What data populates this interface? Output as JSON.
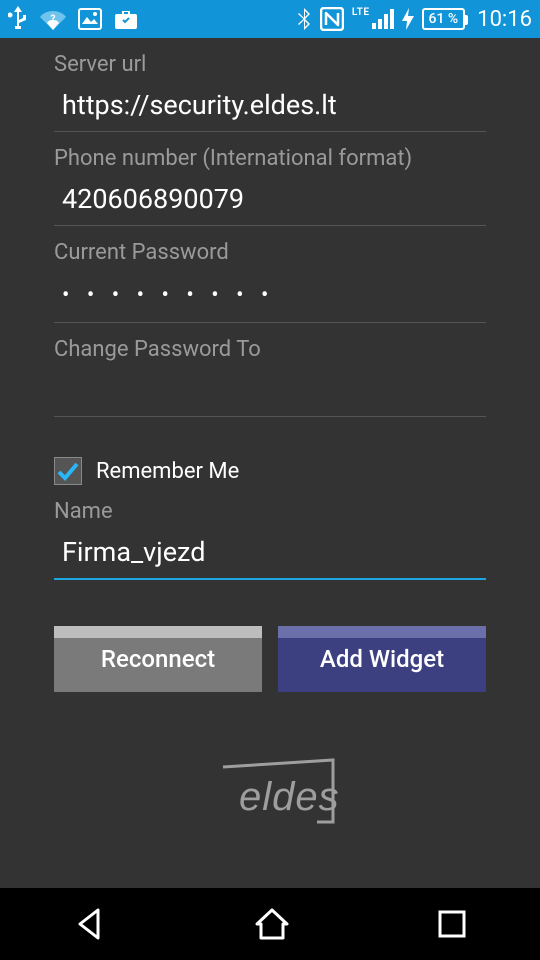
{
  "status": {
    "network_label": "LTE",
    "battery_text": "61 %",
    "time": "10:16"
  },
  "fields": {
    "server_url": {
      "label": "Server url",
      "value": "https://security.eldes.lt"
    },
    "phone": {
      "label": "Phone number (International format)",
      "value": "420606890079"
    },
    "current_pw": {
      "label": "Current Password",
      "masked": "• • • • • • • • •"
    },
    "change_pw": {
      "label": "Change Password To",
      "value": ""
    },
    "name": {
      "label": "Name",
      "value": "Firma_vjezd"
    }
  },
  "remember": {
    "label": "Remember Me",
    "checked": true
  },
  "buttons": {
    "reconnect": "Reconnect",
    "add_widget": "Add Widget"
  },
  "brand": "eldes"
}
